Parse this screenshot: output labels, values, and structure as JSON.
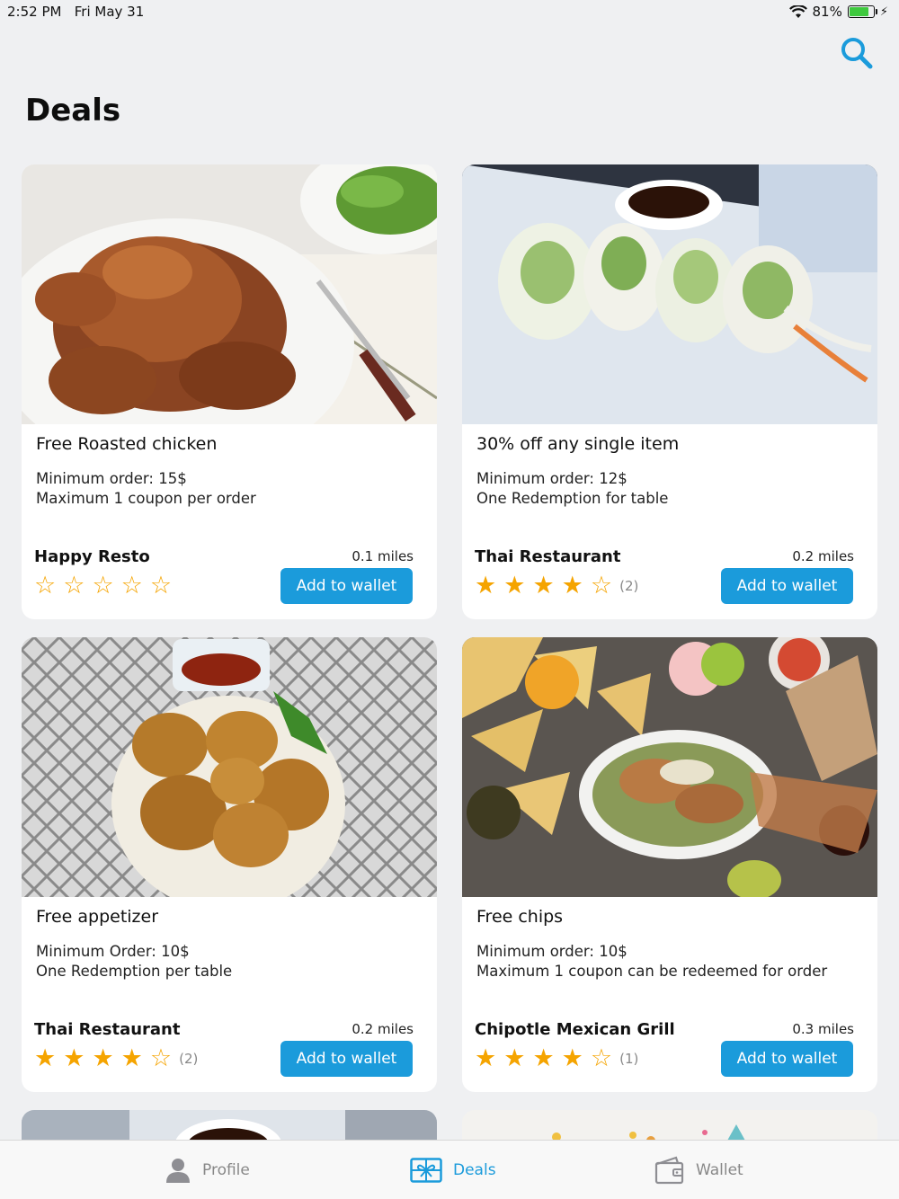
{
  "status_bar": {
    "time": "2:52 PM",
    "date": "Fri May 31",
    "battery": "81%",
    "battery_level": 0.81
  },
  "header": {
    "title": "Deals",
    "search_icon": "search-icon"
  },
  "colors": {
    "accent": "#1b9bdb",
    "star": "#f5a400",
    "background": "#eff0f2"
  },
  "deals": [
    {
      "title": "Free Roasted chicken",
      "line1": "Minimum order: 15$",
      "line2": "Maximum 1 coupon per order",
      "restaurant": "Happy Resto",
      "distance": "0.1 miles",
      "rating": 0,
      "review_count": "",
      "button": "Add to wallet",
      "photo": "roasted-chicken-photo"
    },
    {
      "title": "30% off any single item",
      "line1": "Minimum order: 12$",
      "line2": "One Redemption for table",
      "restaurant": "Thai Restaurant",
      "distance": "0.2 miles",
      "rating": 4,
      "review_count": "(2)",
      "button": "Add to wallet",
      "photo": "spring-rolls-photo"
    },
    {
      "title": "Free appetizer",
      "line1": "Minimum Order: 10$",
      "line2": "One Redemption per table",
      "restaurant": "Thai Restaurant",
      "distance": "0.2 miles",
      "rating": 4,
      "review_count": "(2)",
      "button": "Add to wallet",
      "photo": "fritters-photo"
    },
    {
      "title": "Free chips",
      "line1": "Minimum order: 10$",
      "line2": "Maximum 1 coupon can be redeemed for order",
      "restaurant": "Chipotle Mexican Grill",
      "distance": "0.3 miles",
      "rating": 4,
      "review_count": "(1)",
      "button": "Add to wallet",
      "photo": "chips-bowl-photo"
    }
  ],
  "tabs": [
    {
      "label": "Profile",
      "icon": "person-icon",
      "active": false
    },
    {
      "label": "Deals",
      "icon": "ticket-icon",
      "active": true
    },
    {
      "label": "Wallet",
      "icon": "wallet-icon",
      "active": false
    }
  ]
}
